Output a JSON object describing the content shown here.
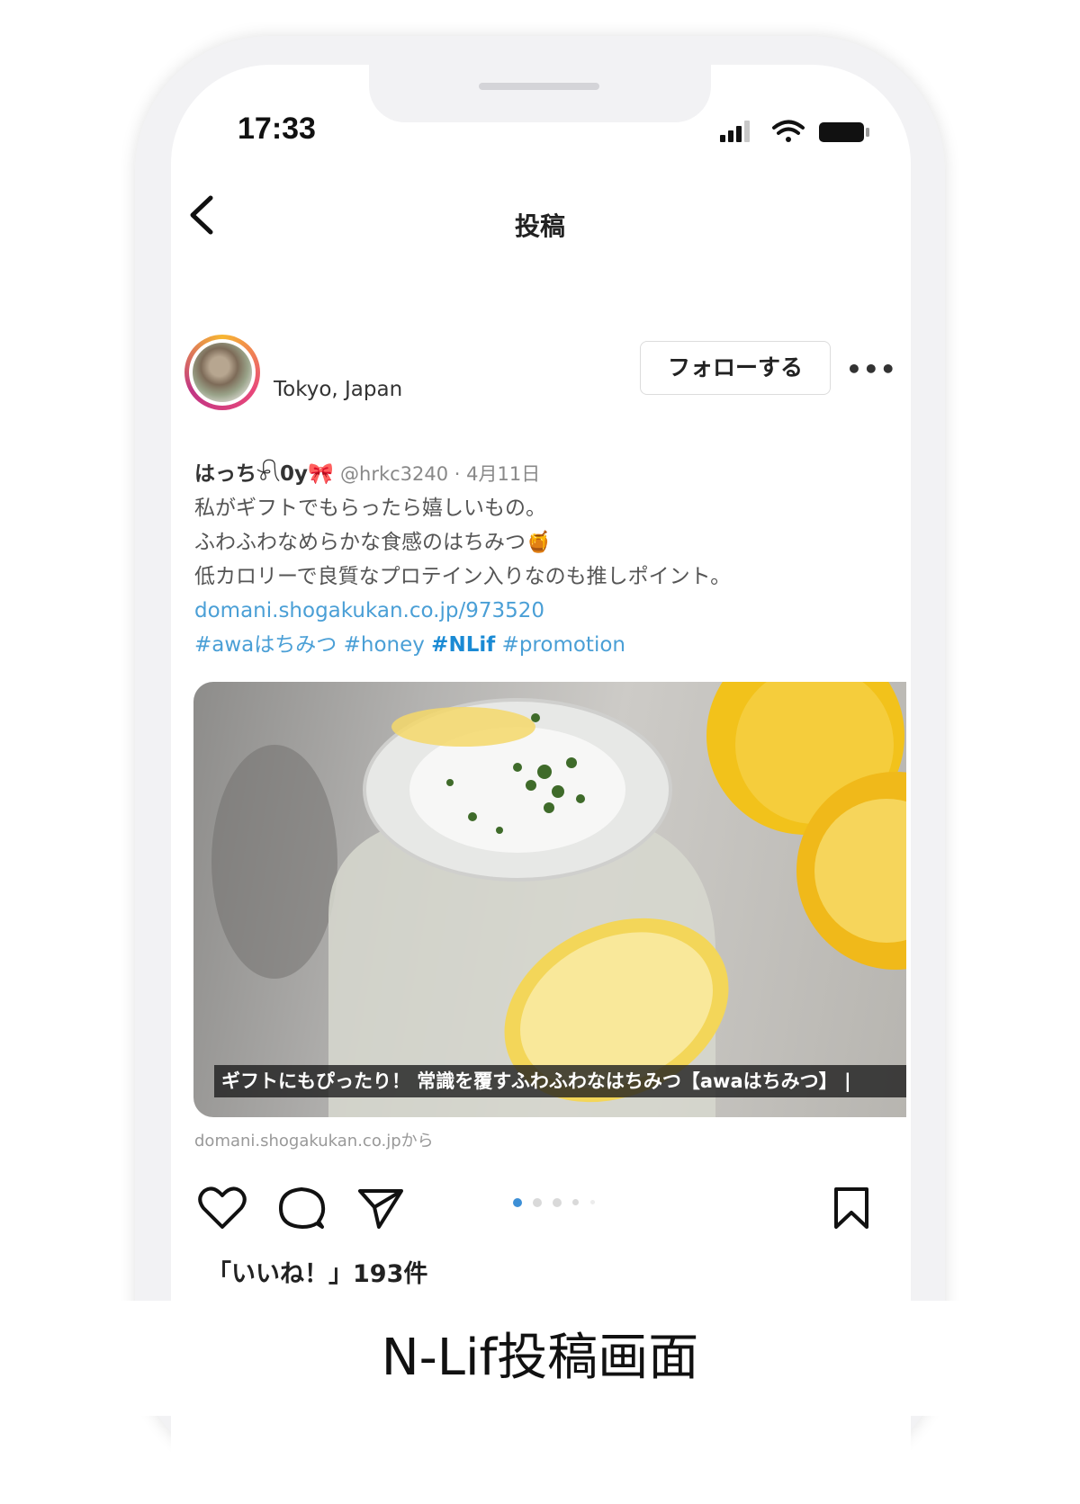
{
  "status_bar": {
    "time": "17:33"
  },
  "header": {
    "title": "投稿"
  },
  "post": {
    "location": "Tokyo, Japan",
    "follow_label": "フォローする",
    "more_label": "•••",
    "tweet": {
      "author": "はっち𓍯0y🎀",
      "handle_date": "@hrkc3240 · 4月11日",
      "lines": [
        "私がギフトでもらったら嬉しいもの。",
        "ふわふわなめらかな食感のはちみつ🍯",
        "低カロリーで良質なプロテイン入りなのも推しポイント。"
      ],
      "link": "domani.shogakukan.co.jp/973520",
      "hashtags": {
        "tag1": "#awaはちみつ",
        "tag2": "#honey",
        "tag3": "#NLif",
        "tag4": "#promotion"
      }
    },
    "media_caption": "ギフトにもぴったり！ 常識を覆すふわふわなはちみつ【awaはちみつ】 |",
    "source": "domani.shogakukan.co.jpから",
    "likes": "「いいね！」193件"
  },
  "footer_caption": "N-Lif投稿画面",
  "colors": {
    "link": "#4a9fd6",
    "hashtag_bold": "#1a8ad4",
    "carousel_active": "#3d8fd6"
  }
}
